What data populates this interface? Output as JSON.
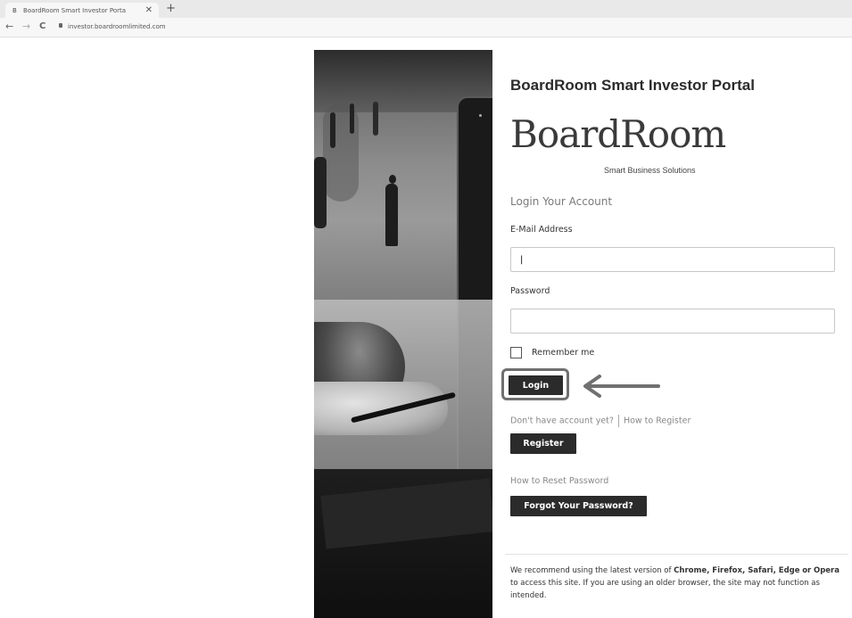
{
  "browser": {
    "tab_title": "BoardRoom Smart Investor Porta",
    "tab_favicon": "B",
    "close_glyph": "✕",
    "new_tab_glyph": "+",
    "back_glyph": "←",
    "forward_glyph": "→",
    "reload_glyph": "C",
    "url": "investor.boardroomlimited.com"
  },
  "page": {
    "site_title": "BoardRoom Smart Investor Portal",
    "logo_text": "BoardRoom",
    "logo_tagline": "Smart Business Solutions",
    "login_heading": "Login Your Account",
    "email_label": "E-Mail Address",
    "email_value": "|",
    "password_label": "Password",
    "password_value": "",
    "remember_label": "Remember me",
    "login_button": "Login",
    "no_account_text": "Don't have account yet?",
    "how_to_register": "How to Register",
    "register_button": "Register",
    "reset_link": "How to Reset Password",
    "forgot_button": "Forgot Your Password?",
    "notice_prefix": "We recommend using the latest version of",
    "notice_browsers": "Chrome, Firefox, Safari, Edge",
    "notice_or": "or",
    "notice_opera": "Opera",
    "notice_suffix": "to access this site. If you are using an older browser, the site may not function as intended."
  },
  "colors": {
    "button_bg": "#2b2b2b",
    "highlight_border": "#707070",
    "link_text": "#888888"
  }
}
